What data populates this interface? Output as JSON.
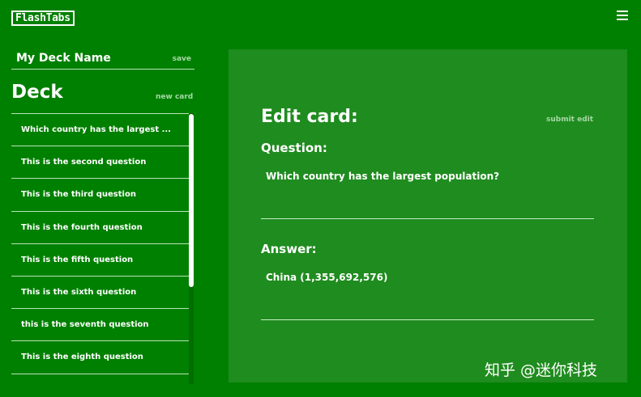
{
  "app": {
    "logo": "FlashTabs",
    "menu_icon": "hamburger-icon"
  },
  "sidebar": {
    "deck_name": "My Deck Name",
    "save_label": "save",
    "deck_heading": "Deck",
    "new_card_label": "new card",
    "cards": [
      "Which country has the largest ...",
      "This is the second question",
      "This is the third question",
      "This is the fourth question",
      "This is the fifth question",
      "This is the sixth question",
      "this is the seventh question",
      "This is the eighth question"
    ]
  },
  "editor": {
    "title": "Edit card:",
    "submit_label": "submit edit",
    "question_label": "Question:",
    "question_value": "Which country has the largest population?",
    "answer_label": "Answer:",
    "answer_value": "China (1,355,692,576)"
  },
  "watermark": "知乎 @迷你科技",
  "colors": {
    "background": "#008000",
    "panel": "#1f8c1f",
    "muted_link": "#a6d8a6",
    "text": "#ffffff"
  }
}
